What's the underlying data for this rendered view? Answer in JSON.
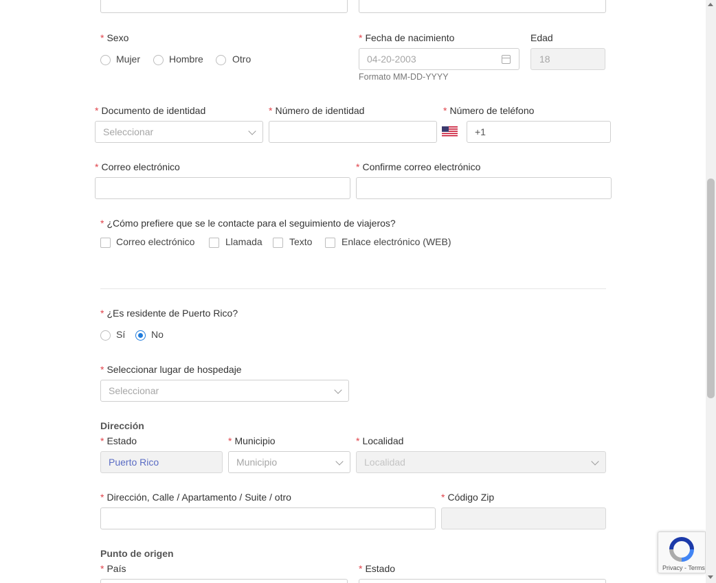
{
  "sexo": {
    "label": "Sexo",
    "options": [
      "Mujer",
      "Hombre",
      "Otro"
    ]
  },
  "fecha": {
    "label": "Fecha de nacimiento",
    "placeholder": "04-20-2003",
    "hint": "Formato MM-DD-YYYY"
  },
  "edad": {
    "label": "Edad",
    "value": "18"
  },
  "documento": {
    "label": "Documento de identidad",
    "placeholder": "Seleccionar"
  },
  "numero_identidad": {
    "label": "Número de identidad",
    "value": ""
  },
  "telefono": {
    "label": "Número de teléfono",
    "prefix": "+1",
    "flag_icon": "us-flag-icon"
  },
  "correo": {
    "label": "Correo electrónico",
    "value": ""
  },
  "confirme_correo": {
    "label": "Confirme correo electrónico",
    "value": ""
  },
  "contacto": {
    "label": "¿Cómo prefiere que se le contacte para el seguimiento de viajeros?",
    "options": [
      "Correo electrónico",
      "Llamada",
      "Texto",
      "Enlace electrónico (WEB)"
    ]
  },
  "residente": {
    "label": "¿Es residente de Puerto Rico?",
    "options": [
      "Sí",
      "No"
    ],
    "selected": "No"
  },
  "hospedaje": {
    "label": "Seleccionar lugar de hospedaje",
    "placeholder": "Seleccionar"
  },
  "direccion": {
    "section": "Dirección",
    "estado_label": "Estado",
    "estado_value": "Puerto Rico",
    "municipio_label": "Municipio",
    "municipio_placeholder": "Municipio",
    "localidad_label": "Localidad",
    "localidad_placeholder": "Localidad",
    "calle_label": "Dirección, Calle / Apartamento / Suite / otro",
    "zip_label": "Código Zip"
  },
  "origen": {
    "section": "Punto de origen",
    "pais_label": "País",
    "estado_label": "Estado"
  },
  "recaptcha": {
    "terms": "Privacy - Terms"
  },
  "colors": {
    "required": "#e0424a",
    "accent": "#1e7bdc",
    "border": "#cfcfcf"
  }
}
